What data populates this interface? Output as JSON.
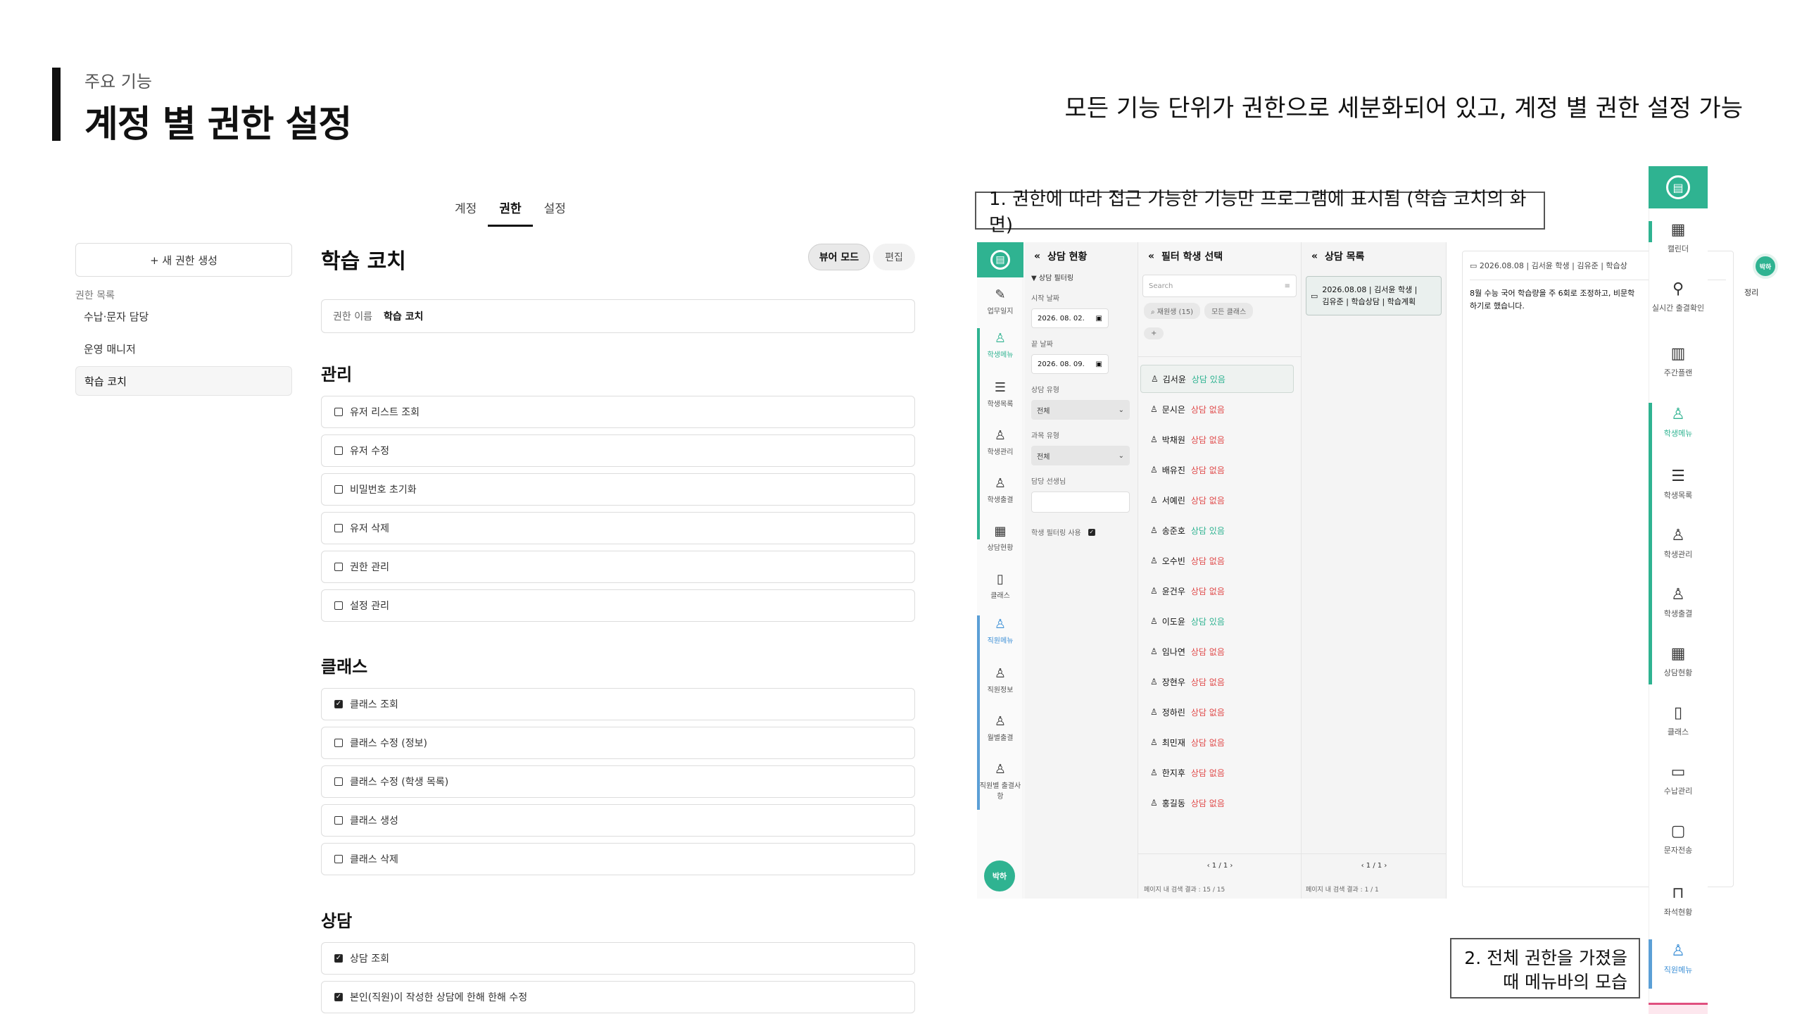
{
  "header": {
    "subtitle": "주요 기능",
    "title": "계정 별 권한 설정",
    "description": "모든 기능 단위가 권한으로 세분화되어 있고, 계정 별 권한 설정 가능"
  },
  "settings": {
    "tabs": [
      {
        "label": "계정",
        "active": false
      },
      {
        "label": "권한",
        "active": true
      },
      {
        "label": "설정",
        "active": false
      }
    ],
    "new_role_label": "+ 새 권한 생성",
    "role_list_heading": "권한 목록",
    "roles": [
      "수납·문자 담당",
      "운영 매니저",
      "학습 코치"
    ],
    "selected_role": "학습 코치",
    "role_title": "학습 코치",
    "view_mode_label": "뷰어 모드",
    "edit_label": "편집",
    "name_label": "권한 이름",
    "name_value": "학습 코치",
    "sections": [
      {
        "title": "관리",
        "items": [
          {
            "label": "유저 리스트 조회",
            "checked": false
          },
          {
            "label": "유저 수정",
            "checked": false
          },
          {
            "label": "비밀번호 초기화",
            "checked": false
          },
          {
            "label": "유저 삭제",
            "checked": false
          },
          {
            "label": "권한 관리",
            "checked": false
          },
          {
            "label": "설정 관리",
            "checked": false
          }
        ]
      },
      {
        "title": "클래스",
        "items": [
          {
            "label": "클래스 조회",
            "checked": true
          },
          {
            "label": "클래스 수정 (정보)",
            "checked": false
          },
          {
            "label": "클래스 수정 (학생 목록)",
            "checked": false
          },
          {
            "label": "클래스 생성",
            "checked": false
          },
          {
            "label": "클래스 삭제",
            "checked": false
          }
        ]
      },
      {
        "title": "상담",
        "items": [
          {
            "label": "상담 조회",
            "checked": true
          },
          {
            "label": "본인(직원)이 작성한 상담에 한해 한해 수정",
            "checked": true
          }
        ]
      }
    ]
  },
  "caption1": "1. 권한에 따라 접근 가능한 기능만 프로그램에 표시됨 (학습 코치의 화면)",
  "caption2_line1": "2. 전체 권한을 가졌을",
  "caption2_line2": "때 메뉴바의 모습",
  "mini_app": {
    "logo_icon": "book-icon",
    "menu": [
      {
        "label": "업무일지",
        "icon": "journal-icon",
        "color": "default"
      },
      {
        "label": "학생메뉴",
        "icon": "student-menu-icon",
        "color": "green"
      },
      {
        "label": "학생목록",
        "icon": "list-icon",
        "color": "default"
      },
      {
        "label": "학생관리",
        "icon": "user-icon",
        "color": "default"
      },
      {
        "label": "학생출결",
        "icon": "user-icon",
        "color": "default"
      },
      {
        "label": "상담현황",
        "icon": "calendar-icon",
        "color": "default"
      },
      {
        "label": "클래스",
        "icon": "book-icon",
        "color": "default"
      },
      {
        "label": "직원메뉴",
        "icon": "staff-menu-icon",
        "color": "blue"
      },
      {
        "label": "직원정보",
        "icon": "user-icon",
        "color": "default"
      },
      {
        "label": "월별출결",
        "icon": "user-icon",
        "color": "default"
      },
      {
        "label": "직원별 출결사항",
        "icon": "user-icon",
        "color": "default"
      }
    ],
    "avatar": "박하",
    "status_panel": {
      "title": "상담 현황",
      "filter_label": "상담 필터링",
      "start_label": "시작 날짜",
      "start_value": "2026. 08. 02.",
      "end_label": "끝 날짜",
      "end_value": "2026. 08. 09.",
      "type_label": "상담 유형",
      "type_value": "전체",
      "subject_label": "과목 유형",
      "subject_value": "전체",
      "teacher_label": "담당 선생님",
      "use_filter_label": "학생 필터링 사용"
    },
    "student_panel": {
      "title": "필터 학생 선택",
      "search_placeholder": "Search",
      "chip1": "재원생 (15)",
      "chip2": "모든 클래스",
      "add": "+",
      "students": [
        {
          "name": "김서윤",
          "status": "상담 있음",
          "has": true
        },
        {
          "name": "문시은",
          "status": "상담 없음",
          "has": false
        },
        {
          "name": "박채원",
          "status": "상담 없음",
          "has": false
        },
        {
          "name": "배유진",
          "status": "상담 없음",
          "has": false
        },
        {
          "name": "서예린",
          "status": "상담 없음",
          "has": false
        },
        {
          "name": "송준호",
          "status": "상담 있음",
          "has": true
        },
        {
          "name": "오수빈",
          "status": "상담 없음",
          "has": false
        },
        {
          "name": "윤건우",
          "status": "상담 없음",
          "has": false
        },
        {
          "name": "이도윤",
          "status": "상담 있음",
          "has": true
        },
        {
          "name": "임나연",
          "status": "상담 없음",
          "has": false
        },
        {
          "name": "장현우",
          "status": "상담 없음",
          "has": false
        },
        {
          "name": "정하린",
          "status": "상담 없음",
          "has": false
        },
        {
          "name": "최민재",
          "status": "상담 없음",
          "has": false
        },
        {
          "name": "한지후",
          "status": "상담 없음",
          "has": false
        },
        {
          "name": "홍길동",
          "status": "상담 없음",
          "has": false
        }
      ],
      "pager": "‹ 1 / 1 ›",
      "result": "페이지 내 검색 결과 : 15 / 15"
    },
    "list_panel": {
      "title": "상담 목록",
      "card_line1": "2026.08.08 | 김서윤 학생 |",
      "card_line2": "김유준 | 학습상담 | 학습계획",
      "pager": "‹ 1 / 1 ›",
      "result": "페이지 내 검색 결과 : 1 / 1"
    },
    "detail": {
      "header": "2026.08.08 | 김서윤 학생 | 김유준 | 학습상",
      "body": "8월 수능 국어 학습량을 주 6회로 조정하고, 비문학",
      "body2": "하기로 했습니다.",
      "overflow": "정리",
      "avatar": "박하"
    }
  },
  "full_menubar": {
    "items": [
      {
        "label": "캘린더",
        "icon": "calendar-icon",
        "color": "default"
      },
      {
        "label": "실시간 출결확인",
        "icon": "attendance-icon",
        "color": "default"
      },
      {
        "label": "주간플랜",
        "icon": "week-plan-icon",
        "color": "default"
      },
      {
        "label": "학생메뉴",
        "icon": "student-menu-icon",
        "color": "green"
      },
      {
        "label": "학생목록",
        "icon": "list-icon",
        "color": "default"
      },
      {
        "label": "학생관리",
        "icon": "user-icon",
        "color": "default"
      },
      {
        "label": "학생출결",
        "icon": "user-icon",
        "color": "default"
      },
      {
        "label": "상담현황",
        "icon": "calendar-icon",
        "color": "default"
      },
      {
        "label": "클래스",
        "icon": "book-icon",
        "color": "default"
      },
      {
        "label": "수납관리",
        "icon": "card-icon",
        "color": "default"
      },
      {
        "label": "문자전송",
        "icon": "message-icon",
        "color": "default"
      },
      {
        "label": "좌석현황",
        "icon": "seat-icon",
        "color": "default"
      },
      {
        "label": "직원메뉴",
        "icon": "staff-menu-icon",
        "color": "blue"
      }
    ]
  },
  "colors": {
    "accent": "#2fb391",
    "blue": "#3b8fd6",
    "danger": "#e04b4b"
  }
}
